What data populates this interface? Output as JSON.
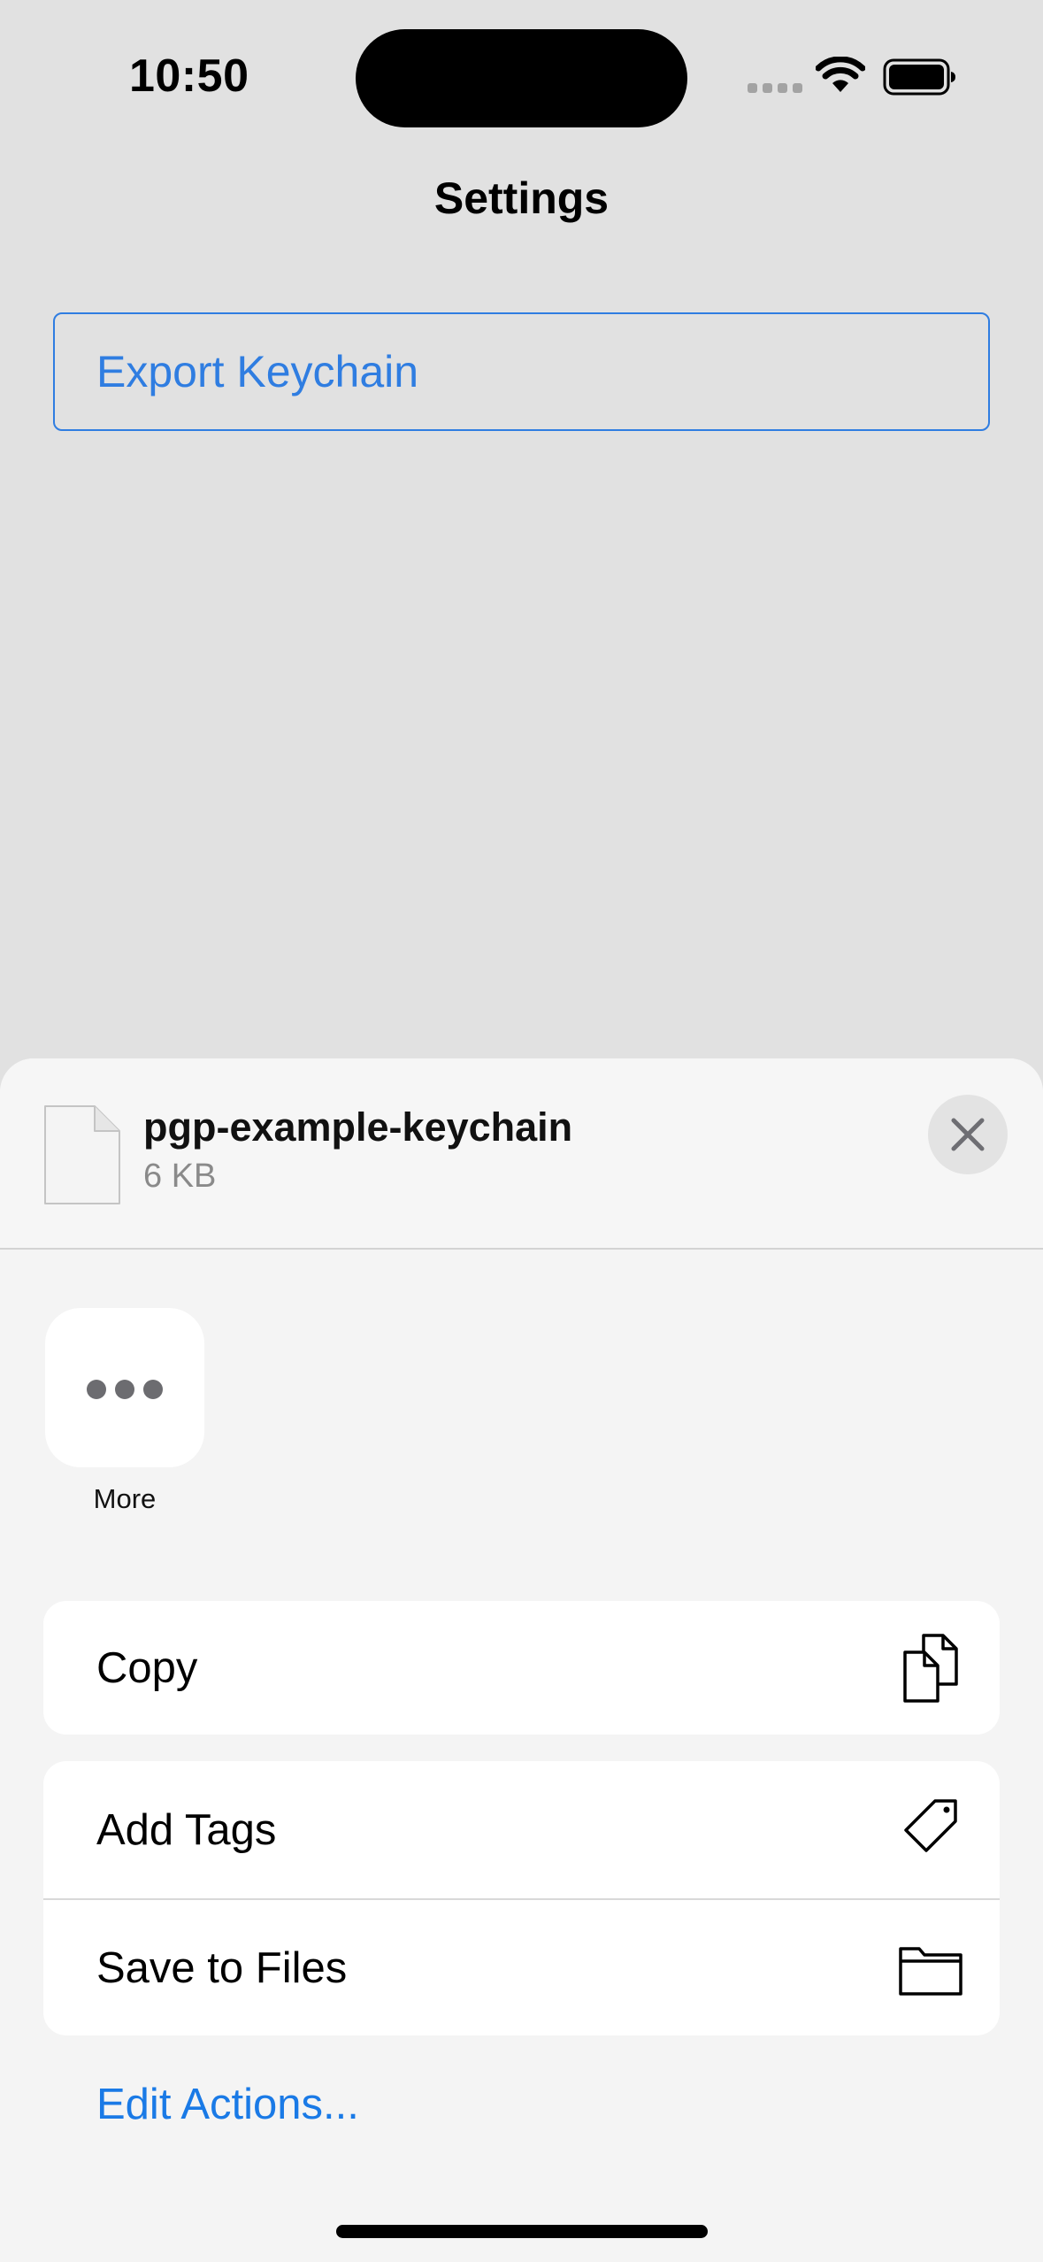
{
  "status_bar": {
    "time": "10:50",
    "icons": [
      "cellular-signal-icon",
      "wifi-icon",
      "battery-icon"
    ]
  },
  "page": {
    "title": "Settings",
    "export_button_label": "Export Keychain"
  },
  "share_sheet": {
    "file_name": "pgp-example-keychain",
    "file_size": "6 KB",
    "file_icon": "document-icon",
    "close_icon": "close-icon",
    "apps": [
      {
        "label": "More",
        "icon": "ellipsis-icon"
      }
    ],
    "action_groups": [
      [
        {
          "label": "Copy",
          "icon": "copy-icon"
        }
      ],
      [
        {
          "label": "Add Tags",
          "icon": "tag-icon"
        },
        {
          "label": "Save to Files",
          "icon": "folder-icon"
        }
      ]
    ],
    "edit_actions_label": "Edit Actions..."
  },
  "colors": {
    "accent": "#2f7de1",
    "link": "#1a7ae6",
    "background": "#e1e1e1",
    "sheet_background": "#f4f4f4"
  }
}
